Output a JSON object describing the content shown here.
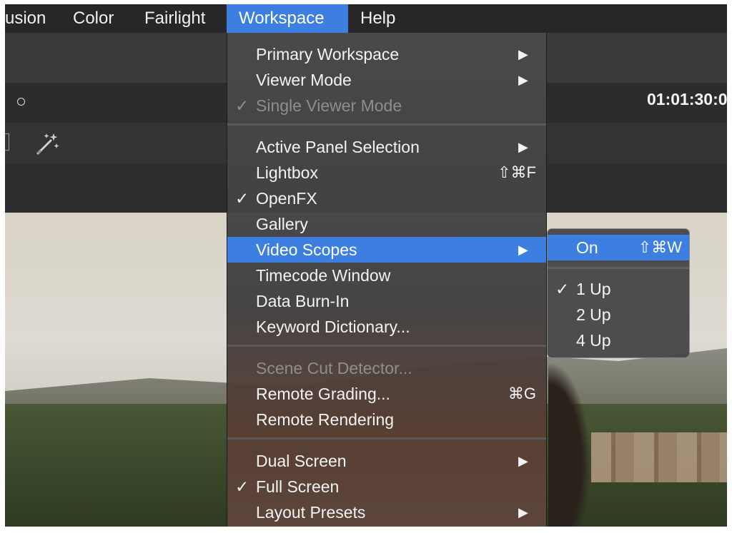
{
  "menubar": {
    "items": [
      {
        "label": "usion",
        "active": false
      },
      {
        "label": "Color",
        "active": false
      },
      {
        "label": "Fairlight",
        "active": false
      },
      {
        "label": "Workspace",
        "active": true
      },
      {
        "label": "Help",
        "active": false
      }
    ]
  },
  "toolbar": {
    "timecode": "01:01:30:0"
  },
  "workspace_menu": {
    "items": [
      {
        "label": "Primary Workspace",
        "submenu": true
      },
      {
        "label": "Viewer Mode",
        "submenu": true
      },
      {
        "label": "Single Viewer Mode",
        "checked": true,
        "disabled": true
      },
      {
        "separator": true
      },
      {
        "label": "Active Panel Selection",
        "submenu": true
      },
      {
        "label": "Lightbox",
        "shortcut": "⇧⌘F"
      },
      {
        "label": "OpenFX",
        "checked": true
      },
      {
        "label": "Gallery"
      },
      {
        "label": "Video Scopes",
        "submenu": true,
        "highlighted": true
      },
      {
        "label": "Timecode Window"
      },
      {
        "label": "Data Burn-In"
      },
      {
        "label": "Keyword Dictionary..."
      },
      {
        "separator": true
      },
      {
        "label": "Scene Cut Detector...",
        "disabled": true
      },
      {
        "label": "Remote Grading...",
        "shortcut": "⌘G"
      },
      {
        "label": "Remote Rendering"
      },
      {
        "separator": true
      },
      {
        "label": "Dual Screen",
        "submenu": true
      },
      {
        "label": "Full Screen",
        "checked": true
      },
      {
        "label": "Layout Presets",
        "submenu": true
      }
    ],
    "check_glyph": "✓",
    "arrow_glyph": "▶"
  },
  "video_scopes_submenu": {
    "on": {
      "label": "On",
      "shortcut": "⇧⌘W"
    },
    "layouts": [
      {
        "label": "1 Up",
        "checked": true
      },
      {
        "label": "2 Up",
        "checked": false
      },
      {
        "label": "4 Up",
        "checked": false
      }
    ]
  },
  "colors": {
    "highlight": "#3d7fe0",
    "menubar": "#27272a",
    "menu_text": "#f3f3f3",
    "disabled_text": "#8e8e8e"
  }
}
